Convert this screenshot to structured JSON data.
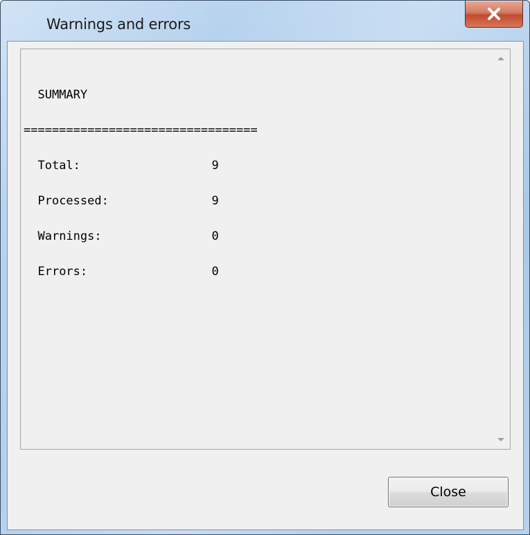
{
  "window": {
    "title": "Warnings and errors"
  },
  "summary": {
    "heading": "SUMMARY",
    "separator": "=================================",
    "rows": [
      {
        "label": "Total:",
        "value": "9"
      },
      {
        "label": "Processed:",
        "value": "9"
      },
      {
        "label": "Warnings:",
        "value": "0"
      },
      {
        "label": "Errors:",
        "value": "0"
      }
    ]
  },
  "buttons": {
    "close_label": "Close"
  },
  "icons": {
    "title_close": "close-icon",
    "scroll_up": "scroll-up-arrow-icon",
    "scroll_down": "scroll-down-arrow-icon"
  },
  "colors": {
    "title_close_button": "#c9553a",
    "client_background": "#f0f0f0",
    "frame": "#a9c9ea"
  }
}
